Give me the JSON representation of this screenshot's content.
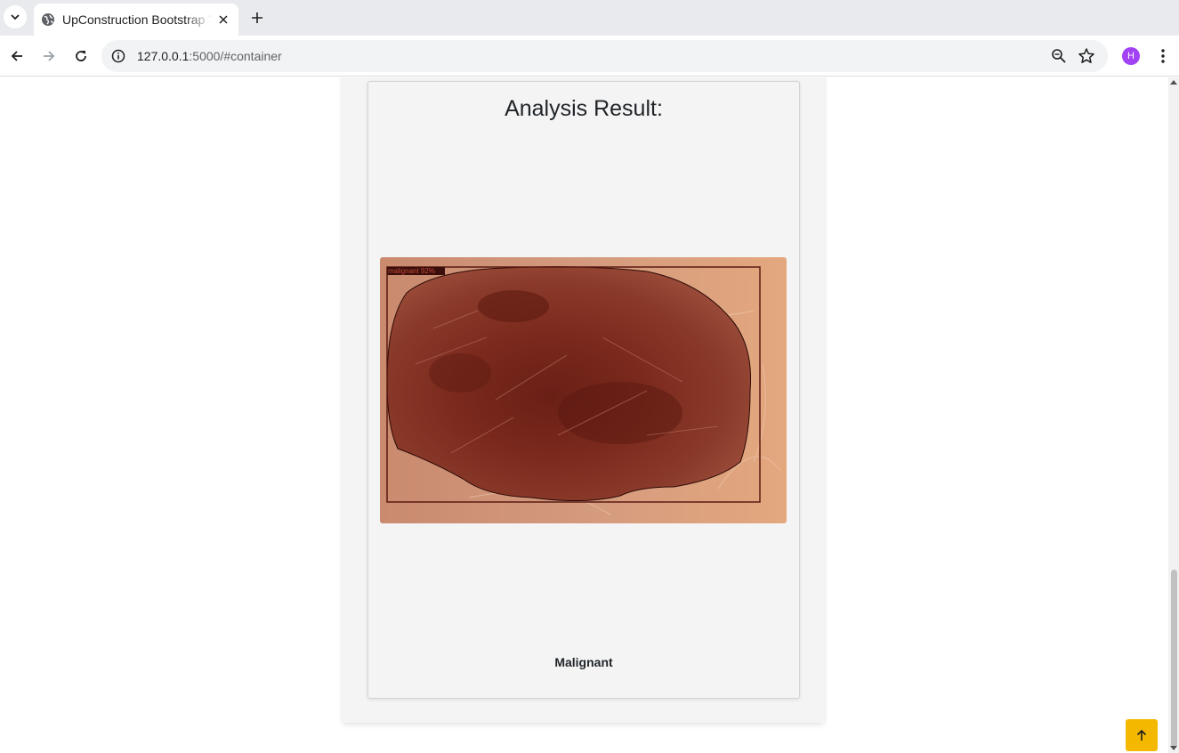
{
  "browser": {
    "tab_title": "UpConstruction Bootstrap Template",
    "url_host": "127.0.0.1",
    "url_rest": ":5000/#container",
    "avatar_letter": "H"
  },
  "page": {
    "title": "Analysis Result:",
    "image_overlay_label": "malignant 92%",
    "diagnosis": "Malignant"
  },
  "colors": {
    "accent": "#f5b800",
    "avatar": "#a142f4",
    "card_bg": "#f4f4f4"
  },
  "icons": {
    "back_to_top": "arrow-up-icon",
    "tab_favicon": "globe-icon"
  }
}
